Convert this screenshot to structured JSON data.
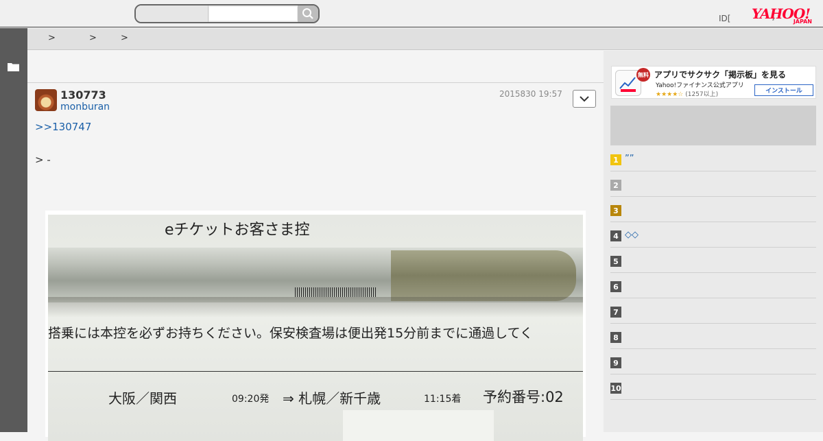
{
  "header": {
    "search_value": "",
    "id_text": "ID[",
    "caret_text": "]",
    "logo_main": "YAHOO!",
    "logo_sub": "JAPAN"
  },
  "breadcrumb": {
    "sep1": ">",
    "sep2": ">",
    "sep3": ">"
  },
  "post": {
    "number": "130773",
    "username": "monburan",
    "timestamp": "2015830 19:57",
    "reply_link": ">>130747",
    "quote": "> -"
  },
  "photo_text": {
    "title": "eチケットお客さま控",
    "notice": "搭乗には本控を必ずお持ちください。保安検査場は便出発15分前までに通過してく",
    "from": "大阪／関西",
    "depart_time": "09:20発",
    "to": "⇒ 札幌／新千歳",
    "arrive_time": "11:15着",
    "booking": "予約番号:02"
  },
  "ad": {
    "badge": "無料",
    "title": "アプリでサクサク「掲示板」を見る",
    "subtitle": "Yahoo!ファイナンス公式アプリ",
    "stars": "★★★★☆",
    "reviews": "(1257以上)",
    "install_label": "インストール"
  },
  "ranking": [
    {
      "num": "1",
      "label": "”” ",
      "color": "#f1c40f"
    },
    {
      "num": "2",
      "label": "",
      "color": "#aaaaaa"
    },
    {
      "num": "3",
      "label": "",
      "color": "#b8860b"
    },
    {
      "num": "4",
      "label": "◇◇",
      "color": "#555555"
    },
    {
      "num": "5",
      "label": "",
      "color": "#555555"
    },
    {
      "num": "6",
      "label": "",
      "color": "#555555"
    },
    {
      "num": "7",
      "label": "",
      "color": "#555555"
    },
    {
      "num": "8",
      "label": "",
      "color": "#555555"
    },
    {
      "num": "9",
      "label": "",
      "color": "#555555"
    },
    {
      "num": "10",
      "label": "",
      "color": "#555555"
    }
  ],
  "colors": {
    "link": "#1a5fa8",
    "brand": "#ff0033"
  }
}
